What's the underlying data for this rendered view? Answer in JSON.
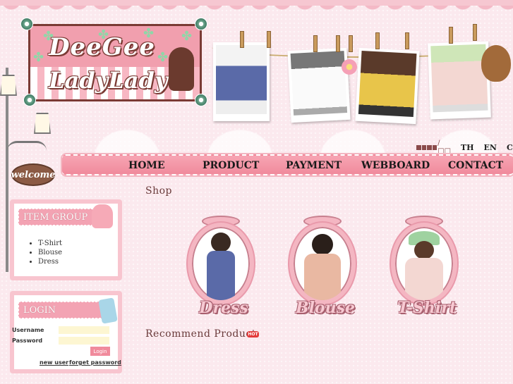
{
  "logo": {
    "line1": "DeeGee",
    "line2": "LadyLady"
  },
  "welcome_sign": "welcome",
  "language": {
    "separator": "/□□",
    "links": [
      "TH",
      "EN",
      "CN"
    ]
  },
  "nav": [
    "HOME",
    "PRODUCT",
    "PAYMENT",
    "WEBBOARD",
    "CONTACT"
  ],
  "item_group": {
    "title": "ITEM GROUP",
    "items": [
      "T-Shirt",
      "Blouse",
      "Dress"
    ]
  },
  "login": {
    "title": "LOGIN",
    "username_label": "Username",
    "password_label": "Password",
    "button": "Login",
    "new_user": "new user",
    "forgot_password": "forget password"
  },
  "shop": {
    "title": "Shop",
    "categories": [
      "Dress",
      "Blouse",
      "T-Shirt"
    ]
  },
  "recommend": {
    "title": "Recommend Product",
    "badge": "HOT"
  },
  "colors": {
    "accent_pink": "#f08a9c",
    "brown": "#7a3a34",
    "background": "#fbe9ee"
  }
}
